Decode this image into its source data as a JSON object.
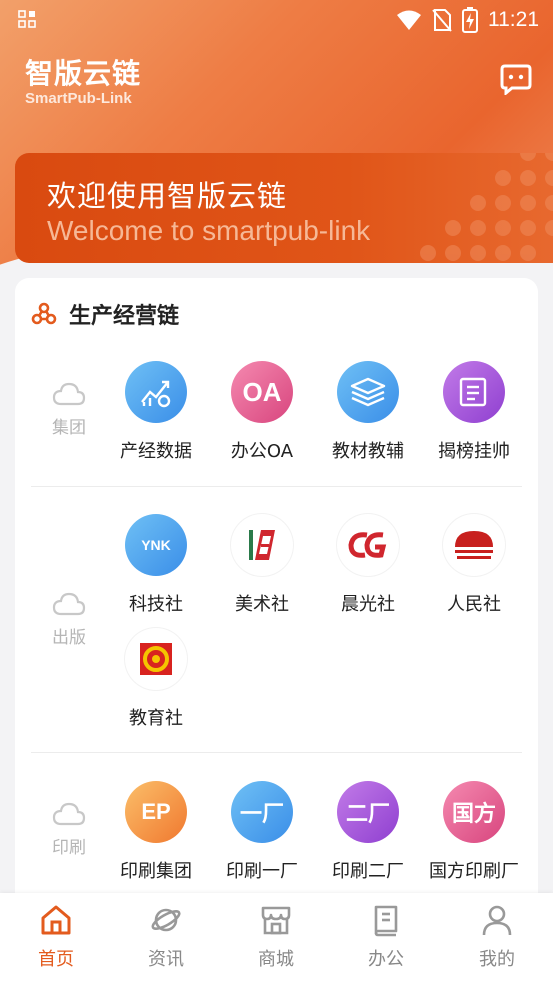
{
  "status_bar": {
    "time": "11:21"
  },
  "header": {
    "title": "智版云链",
    "subtitle": "SmartPub-Link"
  },
  "banner": {
    "title": "欢迎使用智版云链",
    "subtitle": "Welcome to smartpub-link"
  },
  "section": {
    "title": "生产经营链",
    "groups": [
      {
        "label": "集团",
        "items": [
          {
            "label": "产经数据",
            "icon": "chart-gear-icon"
          },
          {
            "label": "办公OA",
            "icon_text": "OA"
          },
          {
            "label": "教材教辅",
            "icon": "books-stack-icon"
          },
          {
            "label": "揭榜挂帅",
            "icon": "document-icon"
          }
        ]
      },
      {
        "label": "出版",
        "items": [
          {
            "label": "科技社",
            "icon_text": "YNK"
          },
          {
            "label": "美术社",
            "icon": "fine-arts-logo"
          },
          {
            "label": "晨光社",
            "icon": "morning-light-logo"
          },
          {
            "label": "人民社",
            "icon": "people-press-logo"
          },
          {
            "label": "教育社",
            "icon": "education-press-logo"
          }
        ]
      },
      {
        "label": "印刷",
        "items": [
          {
            "label": "印刷集团",
            "icon_text": "EP"
          },
          {
            "label": "印刷一厂",
            "icon_text": "一厂"
          },
          {
            "label": "印刷二厂",
            "icon_text": "二厂"
          },
          {
            "label": "国方印刷厂",
            "icon_text": "国方"
          }
        ]
      }
    ]
  },
  "tabbar": {
    "tabs": [
      {
        "label": "首页",
        "icon": "home-icon",
        "active": true
      },
      {
        "label": "资讯",
        "icon": "planet-icon"
      },
      {
        "label": "商城",
        "icon": "store-icon"
      },
      {
        "label": "办公",
        "icon": "book-icon"
      },
      {
        "label": "我的",
        "icon": "user-icon"
      }
    ]
  },
  "colors": {
    "accent": "#e35b1e",
    "header_gradient_start": "#f2a06a",
    "header_gradient_end": "#e9652e"
  }
}
